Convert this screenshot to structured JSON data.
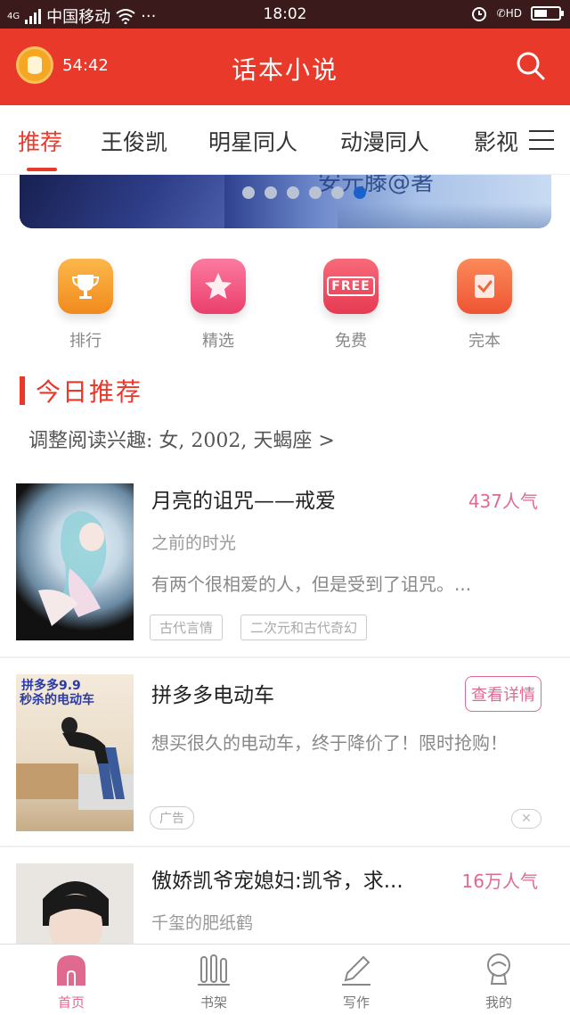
{
  "status_bar": {
    "network": "4G",
    "carrier": "中国移动",
    "more": "···",
    "time": "18:02",
    "call_badge": "HD"
  },
  "header": {
    "timer": "54:42",
    "title": "话本小说"
  },
  "tabs": [
    "推荐",
    "王俊凯",
    "明星同人",
    "动漫同人",
    "影视"
  ],
  "banner": {
    "text": "安元滕@著",
    "dots": 6,
    "active_dot": 5
  },
  "quick_actions": [
    {
      "label": "排行",
      "icon": "trophy-icon",
      "color": "#f6a234"
    },
    {
      "label": "精选",
      "icon": "star-icon",
      "color": "#f1567f"
    },
    {
      "label": "免费",
      "icon": "free-icon",
      "color": "#ee4e62",
      "badge": "FREE"
    },
    {
      "label": "完本",
      "icon": "checked-book-icon",
      "color": "#f26a4a"
    }
  ],
  "section": {
    "title": "今日推荐",
    "preference": "调整阅读兴趣: 女, 2002, 天蝎座 >"
  },
  "books": [
    {
      "title": "月亮的诅咒——戒爱",
      "popularity": "437人气",
      "author": "之前的时光",
      "desc": "有两个很相爱的人，但是受到了诅咒。...",
      "tags": [
        "古代言情",
        "二次元和古代奇幻"
      ]
    },
    {
      "title": "拼多多电动车",
      "detail_button": "查看详情",
      "desc": "想买很久的电动车，终于降价了！限时抢购！",
      "ad_tag": "广告",
      "close": "✕",
      "cover_text": [
        "拼多多9.9",
        "秒杀的电动车"
      ]
    },
    {
      "title": "傲娇凯爷宠媳妇:凯爷，求...",
      "popularity": "16万人气",
      "author": "千玺的肥纸鹤"
    }
  ],
  "bottom_nav": [
    {
      "label": "首页",
      "icon": "home-icon",
      "active": true
    },
    {
      "label": "书架",
      "icon": "bookshelf-icon",
      "active": false
    },
    {
      "label": "写作",
      "icon": "pen-icon",
      "active": false
    },
    {
      "label": "我的",
      "icon": "profile-icon",
      "active": false
    }
  ],
  "colors": {
    "brand": "#e8392b",
    "accent_pink": "#e06a8f",
    "status_bar": "#3a1a1a"
  }
}
